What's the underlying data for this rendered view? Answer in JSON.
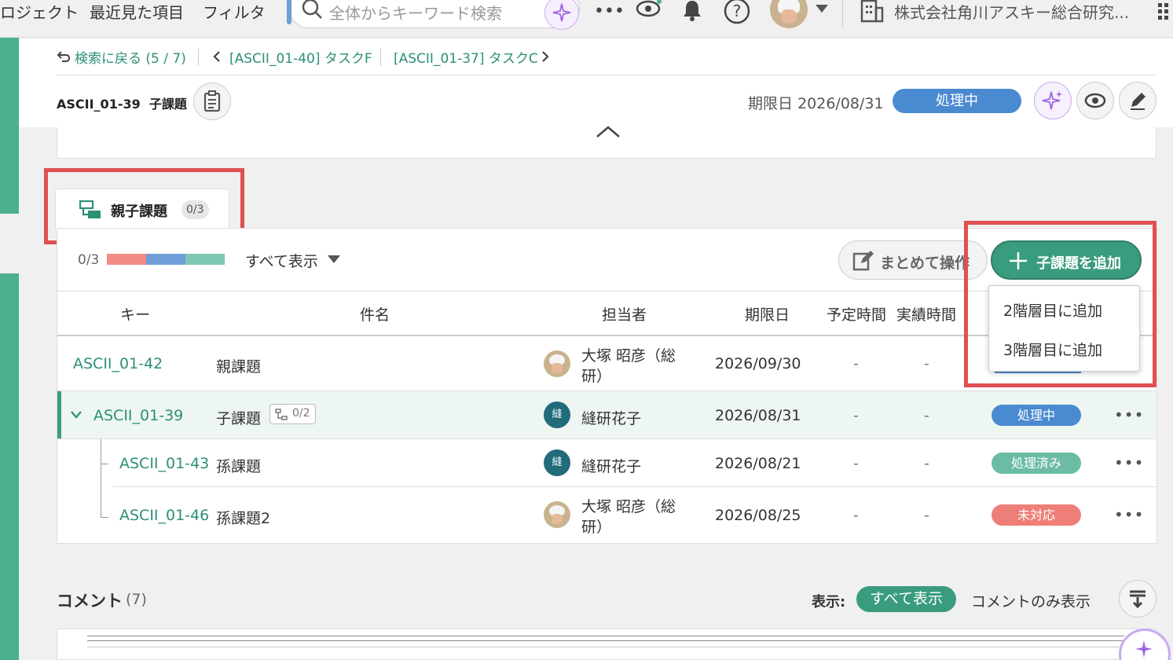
{
  "topnav": {
    "projects": "ロジェクト",
    "recent": "最近見た項目",
    "filter": "フィルタ",
    "search_placeholder": "全体からキーワード検索",
    "org": "株式会社角川アスキー総合研究..."
  },
  "breadcrumb": {
    "back": "検索に戻る (5 / 7)",
    "prev": "[ASCII_01-40] タスクF",
    "next": "[ASCII_01-37] タスクC"
  },
  "issue": {
    "key": "ASCII_01-39",
    "type": "子課題",
    "due_label": "期限日",
    "due": "2026/08/31",
    "status": "処理中"
  },
  "tab": {
    "label": "親子課題",
    "count": "0/3"
  },
  "toolbar": {
    "progress_text": "0/3",
    "progress_segments": [
      {
        "color": "#f28b82",
        "fraction": 0.333
      },
      {
        "color": "#6f9ed8",
        "fraction": 0.333
      },
      {
        "color": "#7fc8b5",
        "fraction": 0.334
      }
    ],
    "filter": "すべて表示",
    "bulk": "まとめて操作",
    "add_child": "子課題を追加"
  },
  "dropdown": {
    "level2": "2階層目に追加",
    "level3": "3階層目に追加"
  },
  "columns": {
    "key": "キー",
    "subject": "件名",
    "assignee": "担当者",
    "due": "期限日",
    "estimated": "予定時間",
    "actual": "実績時間"
  },
  "rows": [
    {
      "key": "ASCII_01-42",
      "subject": "親課題",
      "assignee": "大塚 昭彦（総",
      "assignee2": "研）",
      "due": "2026/09/30",
      "est": "-",
      "act": "-",
      "status": "",
      "status_color": "#4a8ad0"
    },
    {
      "key": "ASCII_01-39",
      "subject": "子課題",
      "sub_count": "0/2",
      "assignee": "縫研花子",
      "avatar": "縫",
      "due": "2026/08/31",
      "est": "-",
      "act": "-",
      "status": "処理中",
      "status_color": "#4a8ad0",
      "more": "•••"
    },
    {
      "key": "ASCII_01-43",
      "subject": "孫課題",
      "assignee": "縫研花子",
      "avatar": "縫",
      "due": "2026/08/21",
      "est": "-",
      "act": "-",
      "status": "処理済み",
      "status_color": "#6bbba5",
      "more": "•••"
    },
    {
      "key": "ASCII_01-46",
      "subject": "孫課題2",
      "assignee": "大塚 昭彦（総",
      "assignee2": "研）",
      "due": "2026/08/25",
      "est": "-",
      "act": "-",
      "status": "未対応",
      "status_color": "#ee7f78",
      "more": "•••"
    }
  ],
  "comments": {
    "title": "コメント",
    "count": "(7)",
    "show_label": "表示:",
    "show_all": "すべて表示",
    "show_comments": "コメントのみ表示"
  }
}
